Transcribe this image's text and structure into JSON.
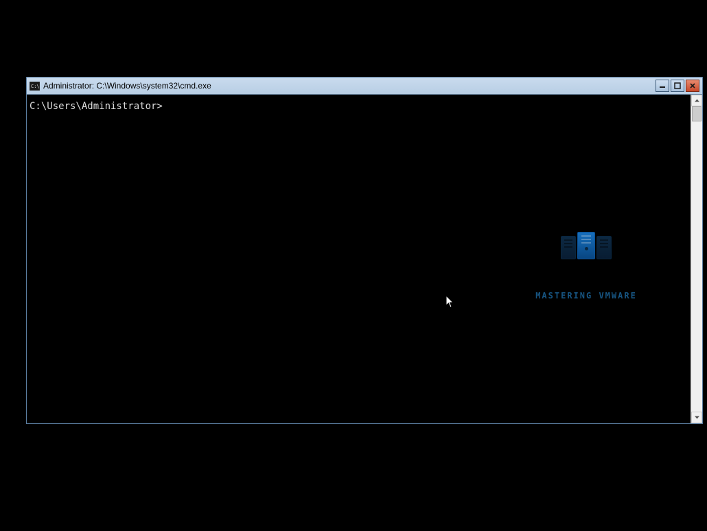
{
  "window": {
    "title": "Administrator: C:\\Windows\\system32\\cmd.exe"
  },
  "terminal": {
    "prompt": "C:\\Users\\Administrator>"
  },
  "watermark": {
    "text": "MASTERING VMWARE"
  }
}
